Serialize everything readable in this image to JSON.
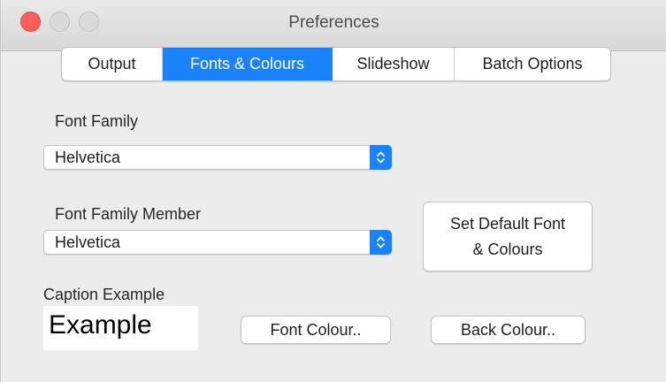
{
  "window": {
    "title": "Preferences"
  },
  "tabs": [
    {
      "label": "Output",
      "active": false
    },
    {
      "label": "Fonts & Colours",
      "active": true
    },
    {
      "label": "Slideshow",
      "active": false
    },
    {
      "label": "Batch Options",
      "active": false
    }
  ],
  "font_family": {
    "label": "Font Family",
    "selected": "Helvetica"
  },
  "font_family_member": {
    "label": "Font Family Member",
    "selected": "Helvetica"
  },
  "set_default_button": {
    "line1": "Set Default Font",
    "line2": "& Colours"
  },
  "caption": {
    "label": "Caption Example",
    "example_text": "Example"
  },
  "font_colour_button": "Font Colour..",
  "back_colour_button": "Back Colour..",
  "colors": {
    "accent": "#1a82fb",
    "close_button": "#fc5f57",
    "window_background": "#ececec"
  },
  "icons": {
    "stepper": "up-down-chevron-icon"
  }
}
